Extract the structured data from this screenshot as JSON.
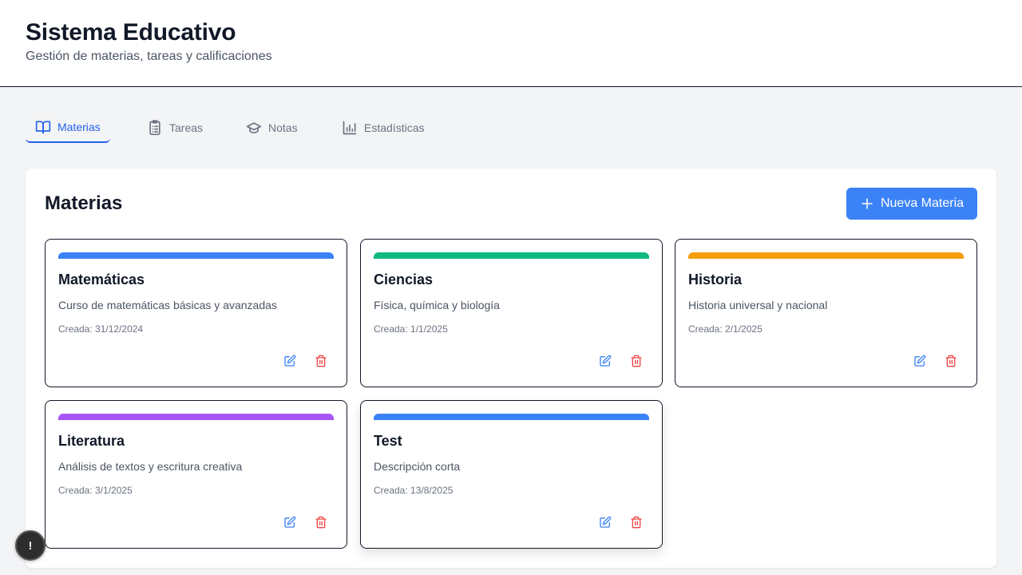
{
  "header": {
    "title": "Sistema Educativo",
    "subtitle": "Gestión de materias, tareas y calificaciones"
  },
  "tabs": [
    {
      "label": "Materias",
      "icon": "book-open-icon",
      "active": true
    },
    {
      "label": "Tareas",
      "icon": "clipboard-list-icon",
      "active": false
    },
    {
      "label": "Notas",
      "icon": "graduation-cap-icon",
      "active": false
    },
    {
      "label": "Estadísticas",
      "icon": "bar-chart-icon",
      "active": false
    }
  ],
  "panel": {
    "title": "Materias",
    "new_button_label": "Nueva Materia"
  },
  "subjects": [
    {
      "name": "Matemáticas",
      "description": "Curso de matemáticas básicas y avanzadas",
      "created": "Creada: 31/12/2024",
      "color": "#3b82f6"
    },
    {
      "name": "Ciencias",
      "description": "Física, química y biología",
      "created": "Creada: 1/1/2025",
      "color": "#10b981"
    },
    {
      "name": "Historia",
      "description": "Historia universal y nacional",
      "created": "Creada: 2/1/2025",
      "color": "#f59e0b"
    },
    {
      "name": "Literatura",
      "description": "Análisis de textos y escritura creativa",
      "created": "Creada: 3/1/2025",
      "color": "#a855f7"
    },
    {
      "name": "Test",
      "description": "Descripción corta",
      "created": "Creada: 13/8/2025",
      "color": "#3b82f6"
    }
  ],
  "help_button": {
    "label": "!"
  },
  "colors": {
    "accent": "#3b82f6",
    "edit_icon": "#3b82f6",
    "delete_icon": "#ef4444"
  }
}
